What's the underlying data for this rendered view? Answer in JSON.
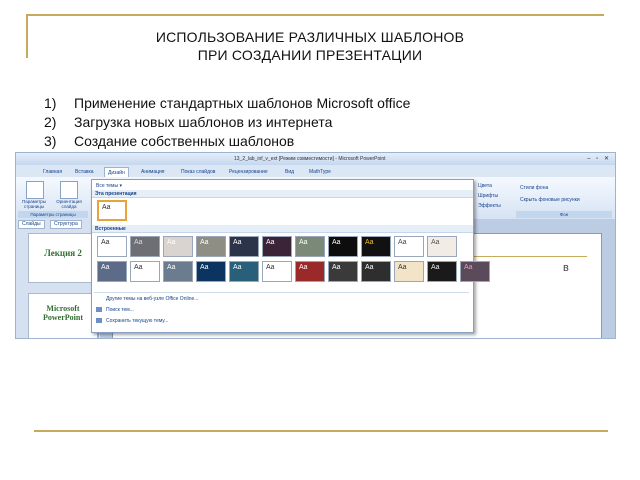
{
  "slide": {
    "title_line1": "ИСПОЛЬЗОВАНИЕ РАЗЛИЧНЫХ ШАБЛОНОВ",
    "title_line2": "ПРИ СОЗДАНИИ ПРЕЗЕНТАЦИИ",
    "list": [
      {
        "num": "1)",
        "text": "Применение стандартных шаблонов Microsoft office"
      },
      {
        "num": "2)",
        "text": "Загрузка новых шаблонов из интернета"
      },
      {
        "num": "3)",
        "text": "Создание собственных шаблонов"
      }
    ],
    "accent_color": "#c8aa5c"
  },
  "screenshot": {
    "window_title": "13_2_lab_inf_v_ext [Режим совместимости] - Microsoft PowerPoint",
    "tabs": [
      "Главная",
      "Вставка",
      "Дизайн",
      "Анимация",
      "Показ слайдов",
      "Рецензирование",
      "Вид",
      "MathType"
    ],
    "active_tab": "Дизайн",
    "ribbon": {
      "page_setup": "Параметры страницы",
      "orientation": "Ориентация слайда",
      "group_page": "Параметры страницы",
      "colors": "Цвета",
      "fonts": "Шрифты",
      "effects": "Эффекты",
      "bg_styles": "Стили фона",
      "hide_bg": "Скрыть фоновые рисунки",
      "group_bg": "Фон"
    },
    "left_panel": {
      "tab_slides": "Слайды",
      "tab_outline": "Структура",
      "thumb1": "Лекция 2",
      "thumb2_line1": "Microsoft",
      "thumb2_line2": "PowerPoint"
    },
    "slide_fragment": "в",
    "gallery": {
      "menu": "Все темы ▾",
      "section_this": "Эта презентация",
      "section_builtin": "Встроенные",
      "sample": "Aa",
      "links": [
        "Другие темы на веб-узле Office Online...",
        "Поиск тем...",
        "Сохранить текущую тему..."
      ]
    }
  }
}
